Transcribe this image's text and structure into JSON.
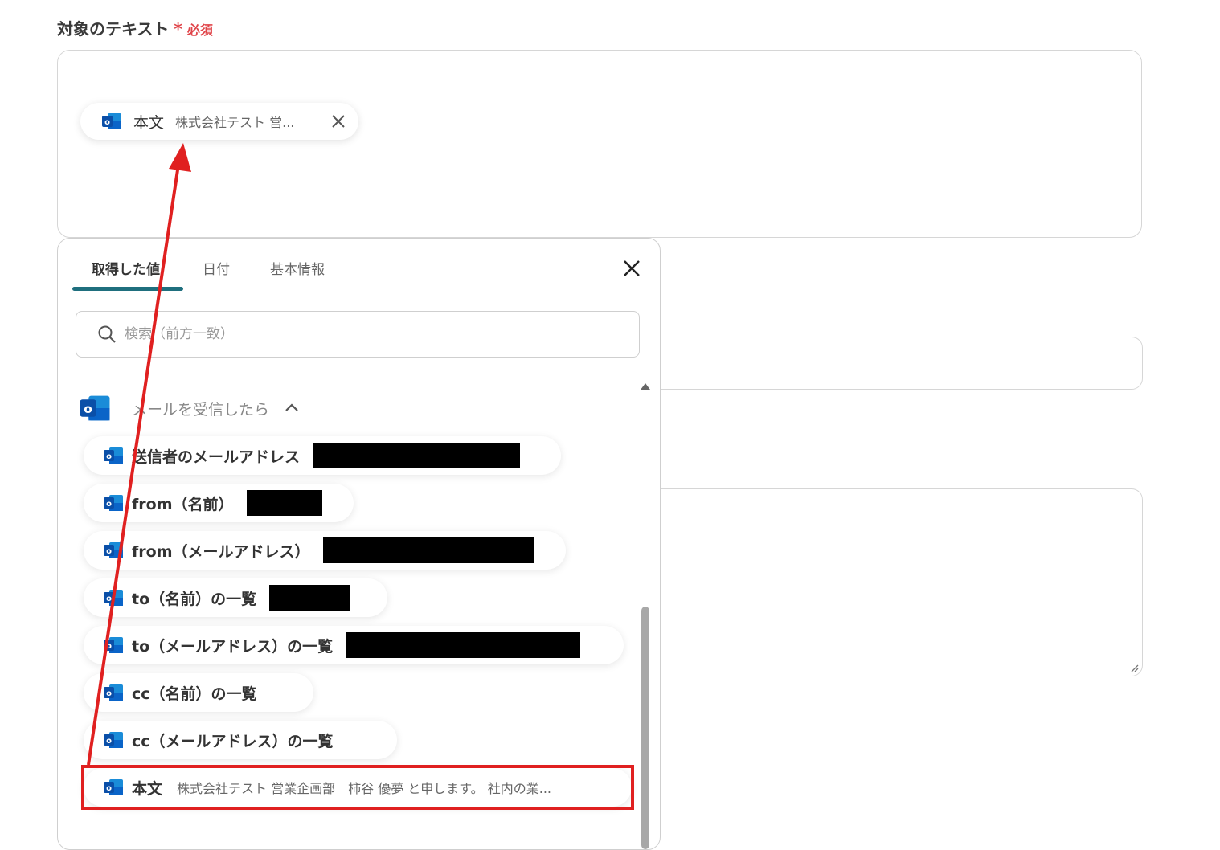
{
  "field": {
    "label": "対象のテキスト",
    "required_mark": "*",
    "required_text": "必須"
  },
  "token": {
    "name": "本文",
    "preview": "株式会社テスト 営..."
  },
  "panel": {
    "tabs": [
      "取得した値",
      "日付",
      "基本情報"
    ],
    "active_tab": 0,
    "search_placeholder": "検索（前方一致）",
    "group_label": "メールを受信したら",
    "items": [
      {
        "label": "送信者のメールアドレス",
        "redacted": true
      },
      {
        "label": "from（名前）",
        "redacted": true
      },
      {
        "label": "from（メールアドレス）",
        "redacted": true
      },
      {
        "label": "to（名前）の一覧",
        "redacted": true
      },
      {
        "label": "to（メールアドレス）の一覧",
        "redacted": true
      },
      {
        "label": "cc（名前）の一覧",
        "redacted": false
      },
      {
        "label": "cc（メールアドレス）の一覧",
        "redacted": false
      },
      {
        "label": "本文",
        "preview": "株式会社テスト 営業企画部　柿谷 優夢 と申します。 社内の業..."
      }
    ]
  },
  "colors": {
    "accent": "#1f6f7e",
    "required": "#e0454a",
    "annotation": "#e02020",
    "outlook_blue": "#0a64c8"
  },
  "icons": [
    "outlook-icon",
    "close-icon",
    "search-icon",
    "chevron-up-icon",
    "scroll-up-arrow-icon",
    "resize-grip-icon"
  ]
}
